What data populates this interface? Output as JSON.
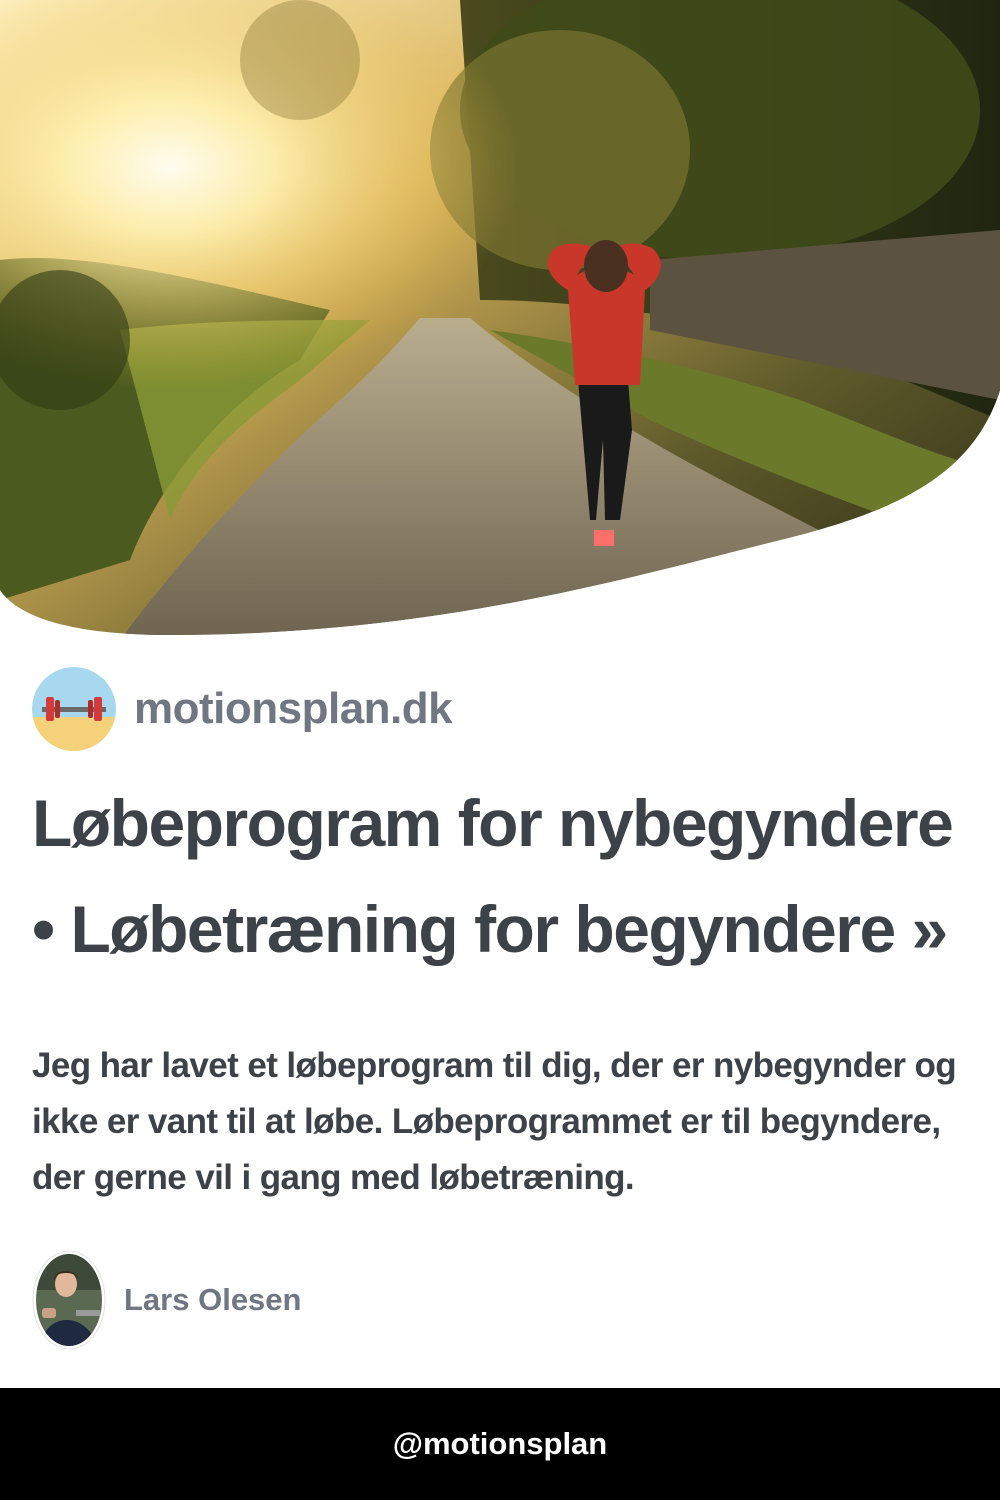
{
  "site": {
    "name": "motionsplan.dk",
    "logo_icon": "barbell-icon"
  },
  "article": {
    "title": "Løbeprogram for nybegyndere • Løbetræning for begyndere »",
    "description": "Jeg har lavet et løbeprogram til dig, der er nybegynder og ikke er vant til at løbe. Løbeprogrammet er til begyndere, der gerne vil i gang med løbetræning."
  },
  "author": {
    "name": "Lars Olesen"
  },
  "footer": {
    "handle": "@motionsplan"
  },
  "colors": {
    "headline": "#3d4148",
    "muted": "#707782",
    "footer_bg": "#000000",
    "footer_text": "#ffffff"
  }
}
